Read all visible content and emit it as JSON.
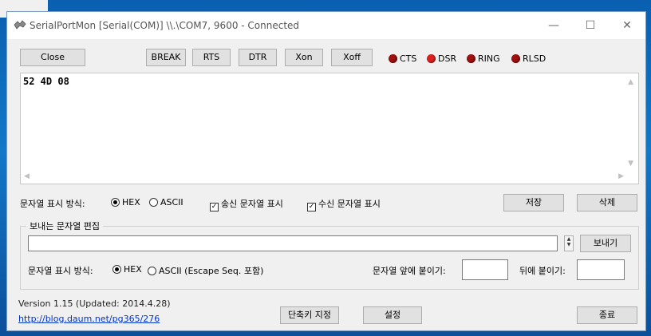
{
  "window": {
    "title": "SerialPortMon [Serial(COM)] \\\\.\\COM7, 9600 - Connected",
    "minimize_glyph": "—",
    "maximize_glyph": "☐",
    "close_glyph": "✕"
  },
  "toolbar": {
    "close_label": "Close",
    "break_label": "BREAK",
    "rts_label": "RTS",
    "dtr_label": "DTR",
    "xon_label": "Xon",
    "xoff_label": "Xoff"
  },
  "indicators": [
    {
      "label": "CTS",
      "color": "#a01010"
    },
    {
      "label": "DSR",
      "color": "#e02020"
    },
    {
      "label": "RING",
      "color": "#a01010"
    },
    {
      "label": "RLSD",
      "color": "#a01010"
    }
  ],
  "receive": {
    "text": "52 4D 08"
  },
  "display": {
    "format_label": "문자열 표시 방식:",
    "hex_label": "HEX",
    "ascii_label": "ASCII",
    "hex_selected": true,
    "show_sent_label": "송신 문자열 표시",
    "show_sent_checked": true,
    "show_recv_label": "수신 문자열 표시",
    "show_recv_checked": true,
    "save_label": "저장",
    "delete_label": "삭제"
  },
  "send": {
    "group_title": "보내는 문자열 편집",
    "input_value": "",
    "send_label": "보내기",
    "format_label": "문자열 표시 방식:",
    "hex_label": "HEX",
    "ascii_label": "ASCII (Escape Seq. 포함)",
    "hex_selected": true,
    "prefix_label": "문자열 앞에 붙이기:",
    "prefix_value": "",
    "suffix_label": "뒤에 붙이기:",
    "suffix_value": ""
  },
  "footer": {
    "version": "Version 1.15 (Updated: 2014.4.28)",
    "link": "http://blog.daum.net/pg365/276",
    "shortcut_label": "단축키 지정",
    "settings_label": "설정",
    "exit_label": "종료"
  }
}
